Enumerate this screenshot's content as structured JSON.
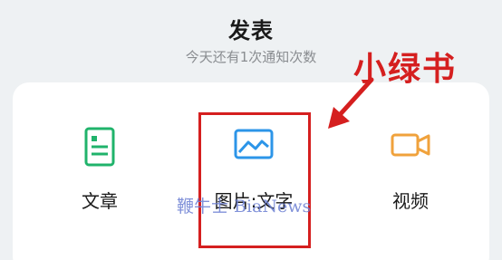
{
  "header": {
    "title": "发表",
    "subtitle": "今天还有1次通知次数"
  },
  "options": [
    {
      "label": "文章",
      "icon": "document-icon",
      "color": "#20b36b"
    },
    {
      "label": "图片:文字",
      "icon": "image-icon",
      "color": "#2c95e8"
    },
    {
      "label": "视频",
      "icon": "video-camera-icon",
      "color": "#f0a23c"
    }
  ],
  "annotation": {
    "text": "小绿书",
    "color": "#d51f1f"
  },
  "watermark": {
    "text": "鞭牛士 BiaNews"
  }
}
